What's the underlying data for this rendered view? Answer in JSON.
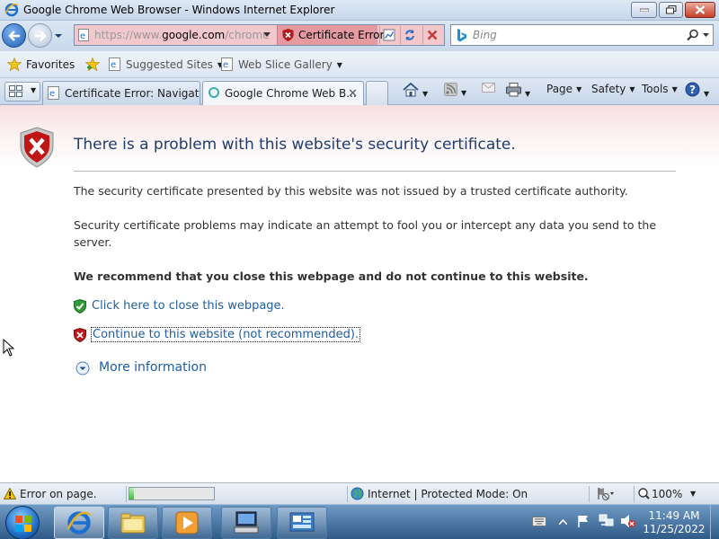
{
  "window": {
    "title": "Google Chrome Web Browser - Windows Internet Explorer"
  },
  "address_bar": {
    "url_scheme_host": "https://www.",
    "url_domain": "google.com",
    "url_path": "/chrome",
    "cert_error_label": "Certificate Error"
  },
  "search": {
    "placeholder": "Bing"
  },
  "favorites_bar": {
    "favorites_label": "Favorites",
    "suggested_sites": "Suggested Sites",
    "web_slice_gallery": "Web Slice Gallery"
  },
  "tabs": [
    {
      "label": "Certificate Error: Navigatio..."
    },
    {
      "label": "Google Chrome Web B..."
    }
  ],
  "command_bar": {
    "page": "Page",
    "safety": "Safety",
    "tools": "Tools"
  },
  "content": {
    "heading": "There is a problem with this website's security certificate.",
    "para1": "The security certificate presented by this website was not issued by a trusted certificate authority.",
    "para2": "Security certificate problems may indicate an attempt to fool you or intercept any data you send to the server.",
    "recommend": "We recommend that you close this webpage and do not continue to this website.",
    "close_link": "Click here to close this webpage.",
    "continue_link": "Continue to this website (not recommended).",
    "more_info": "More information"
  },
  "status_bar": {
    "error_text": "Error on page.",
    "zone_text": "Internet | Protected Mode: On",
    "zoom": "100%",
    "progress_fraction": 0.05
  },
  "taskbar": {
    "time": "11:49 AM",
    "date": "11/25/2022"
  },
  "colors": {
    "link": "#1f5ea0",
    "heading": "#1f3d6e",
    "cert_error_bg": "#e59aa2"
  }
}
